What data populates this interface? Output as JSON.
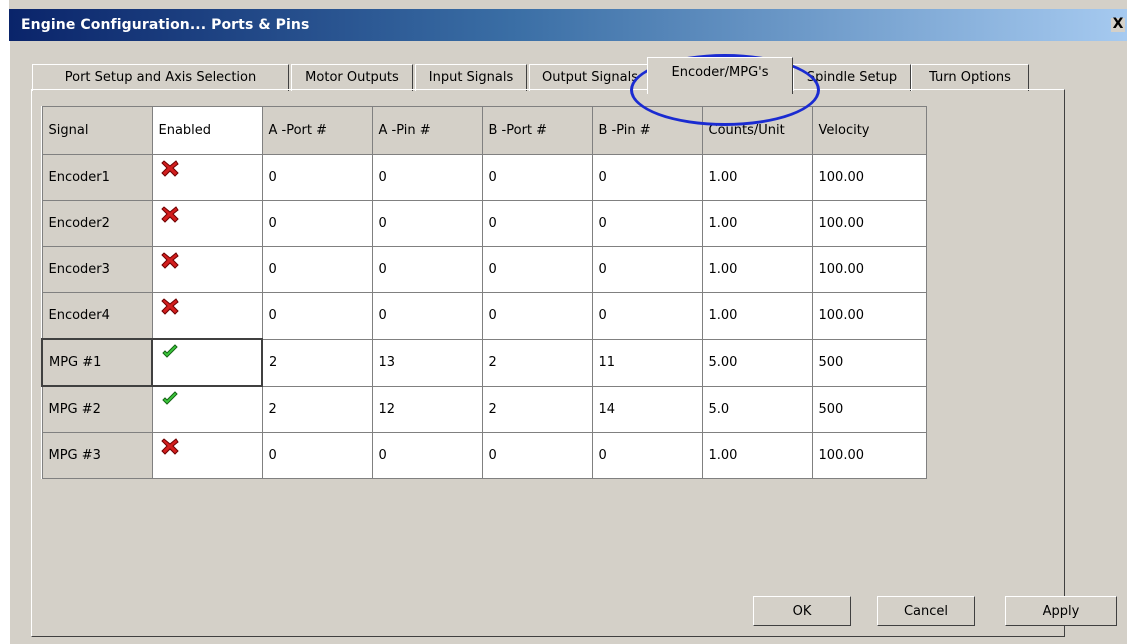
{
  "window": {
    "title": "Engine Configuration... Ports & Pins",
    "close_label": "X"
  },
  "tabs": [
    {
      "label": "Port Setup and Axis Selection"
    },
    {
      "label": "Motor Outputs"
    },
    {
      "label": "Input Signals"
    },
    {
      "label": "Output Signals"
    },
    {
      "label": "Encoder/MPG's",
      "active": true
    },
    {
      "label": "Spindle Setup"
    },
    {
      "label": "Turn Options"
    }
  ],
  "table": {
    "headers": [
      "Signal",
      "Enabled",
      "A -Port #",
      "A -Pin  #",
      "B -Port #",
      "B -Pin  #",
      "Counts/Unit",
      "Velocity"
    ],
    "rows": [
      {
        "signal": "Encoder1",
        "enabled": false,
        "a_port": "0",
        "a_pin": "0",
        "b_port": "0",
        "b_pin": "0",
        "counts": "1.00",
        "velocity": "100.00"
      },
      {
        "signal": "Encoder2",
        "enabled": false,
        "a_port": "0",
        "a_pin": "0",
        "b_port": "0",
        "b_pin": "0",
        "counts": "1.00",
        "velocity": "100.00"
      },
      {
        "signal": "Encoder3",
        "enabled": false,
        "a_port": "0",
        "a_pin": "0",
        "b_port": "0",
        "b_pin": "0",
        "counts": "1.00",
        "velocity": "100.00"
      },
      {
        "signal": "Encoder4",
        "enabled": false,
        "a_port": "0",
        "a_pin": "0",
        "b_port": "0",
        "b_pin": "0",
        "counts": "1.00",
        "velocity": "100.00"
      },
      {
        "signal": "MPG #1",
        "enabled": true,
        "a_port": "2",
        "a_pin": "13",
        "b_port": "2",
        "b_pin": "11",
        "counts": "5.00",
        "velocity": "500"
      },
      {
        "signal": "MPG #2",
        "enabled": true,
        "a_port": "2",
        "a_pin": "12",
        "b_port": "2",
        "b_pin": "14",
        "counts": "5.0",
        "velocity": "500"
      },
      {
        "signal": "MPG #3",
        "enabled": false,
        "a_port": "0",
        "a_pin": "0",
        "b_port": "0",
        "b_pin": "0",
        "counts": "1.00",
        "velocity": "100.00"
      }
    ]
  },
  "buttons": {
    "ok": "OK",
    "cancel": "Cancel",
    "apply": "Apply"
  },
  "icons": {
    "enabled": "green-check-icon",
    "disabled": "red-x-icon"
  },
  "colors": {
    "title_start": "#0a246a",
    "title_end": "#a6caf0",
    "highlight": "#1a2bd1",
    "check": "#3cc83c",
    "cross": "#d21e1e"
  }
}
